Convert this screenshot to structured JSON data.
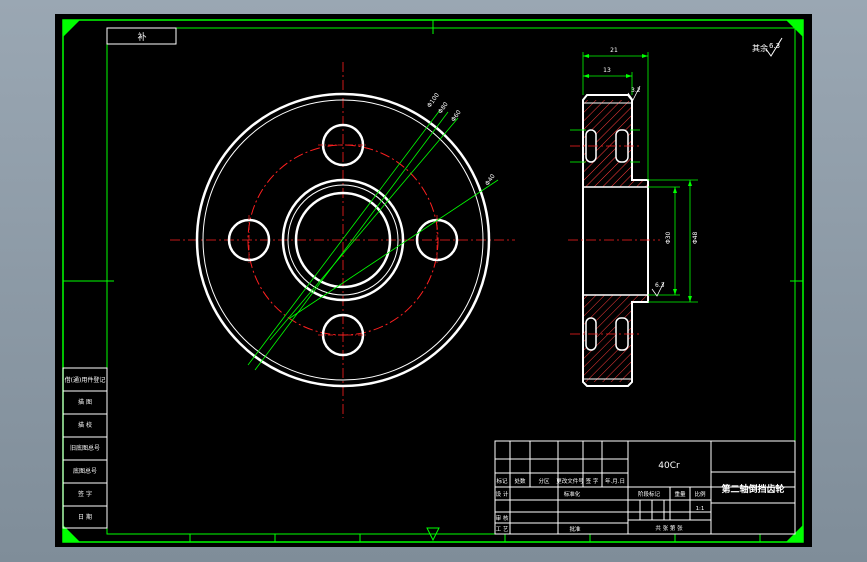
{
  "colors": {
    "background": "#000000",
    "frame": "#00ff00",
    "part": "#ffffff",
    "centerline": "#ff2020",
    "dimension": "#00ff00",
    "hatch": "#ff3b3b",
    "viewport": "#8f9ca8"
  },
  "drawing": {
    "top_left_tag": "补",
    "roughness_note": "其余",
    "roughness_value": "6.3"
  },
  "side_view_dims": {
    "overall_width": "21",
    "rim_width": "13",
    "bore": "Φ30",
    "hub_dia": "Φ48",
    "rough_hub": "6.3",
    "rough_rim": "3.2"
  },
  "front_view_leaders": [
    "Φ100",
    "Φ80",
    "Φ60",
    "Φ40"
  ],
  "left_column": [
    "借(通)用件登记",
    "描 图",
    "描 校",
    "旧底图总号",
    "底图总号",
    "签 字",
    "日 期"
  ],
  "title_block": {
    "material": "40Cr",
    "part_name": "第二轴倒挡齿轮",
    "headers": [
      "标记",
      "处数",
      "分区",
      "更改文件号",
      "签 字",
      "年.月.日"
    ],
    "rows_left": [
      "设 计",
      "",
      "审 核",
      "工 艺"
    ],
    "std_cell": "标准化",
    "approve": "批准",
    "stage_label": "阶段标记",
    "weight_label": "重量",
    "scale_label": "比例",
    "scale_value": "1:1",
    "sheet_label": "共 张 第 张"
  }
}
